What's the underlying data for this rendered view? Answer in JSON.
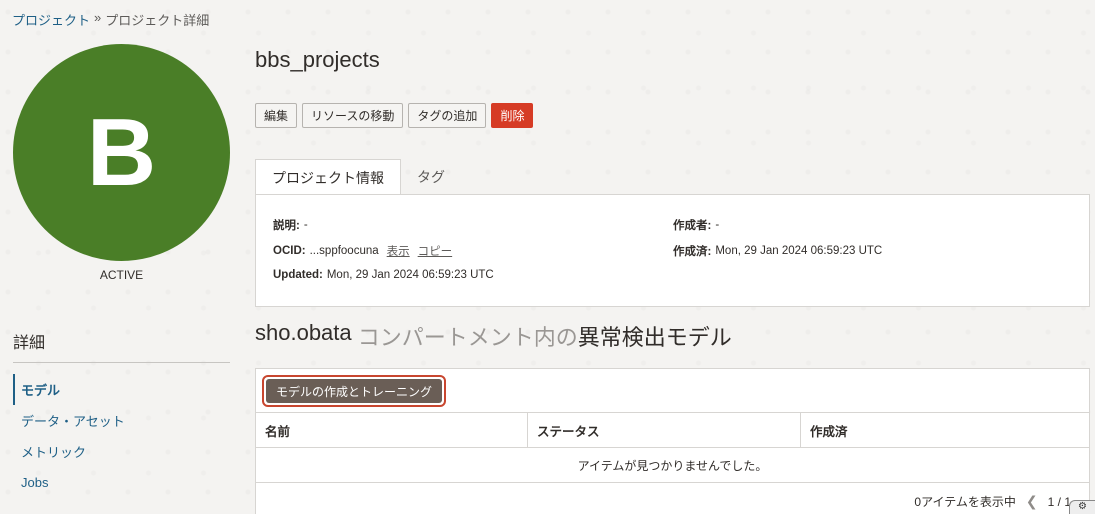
{
  "breadcrumb": {
    "items": [
      "プロジェクト",
      "プロジェクト詳細"
    ],
    "separator": "»"
  },
  "avatar": {
    "letter": "B",
    "status": "ACTIVE",
    "color": "#4a7e27"
  },
  "left_nav": {
    "heading": "詳細",
    "items": [
      {
        "label": "モデル",
        "active": true
      },
      {
        "label": "データ・アセット",
        "active": false
      },
      {
        "label": "メトリック",
        "active": false
      },
      {
        "label": "Jobs",
        "active": false
      }
    ]
  },
  "page": {
    "title": "bbs_projects"
  },
  "actions": {
    "edit": "編集",
    "move": "リソースの移動",
    "add_tag": "タグの追加",
    "delete": "削除"
  },
  "tabs": [
    {
      "label": "プロジェクト情報",
      "active": true
    },
    {
      "label": "タグ",
      "active": false
    }
  ],
  "project_info": {
    "description_label": "説明:",
    "description_value": "-",
    "ocid_label": "OCID:",
    "ocid_value": "...sppfoocuna",
    "show_link": "表示",
    "copy_link": "コピー",
    "updated_label": "Updated:",
    "updated_value": "Mon, 29 Jan 2024 06:59:23 UTC",
    "creator_label": "作成者:",
    "creator_value": "-",
    "created_label": "作成済:",
    "created_value": "Mon, 29 Jan 2024 06:59:23 UTC"
  },
  "section": {
    "compartment": "sho.obata",
    "middle": " コンパートメント内の",
    "title": "異常検出モデル"
  },
  "models_table": {
    "create_button": "モデルの作成とトレーニング",
    "columns": [
      "名前",
      "ステータス",
      "作成済"
    ],
    "empty_message": "アイテムが見つかりませんでした。",
    "pager_text": "0アイテムを表示中",
    "page_indicator": "1 / 1"
  },
  "colors": {
    "link": "#1e5f86",
    "danger": "#d63b25",
    "highlight": "#c8462f"
  }
}
